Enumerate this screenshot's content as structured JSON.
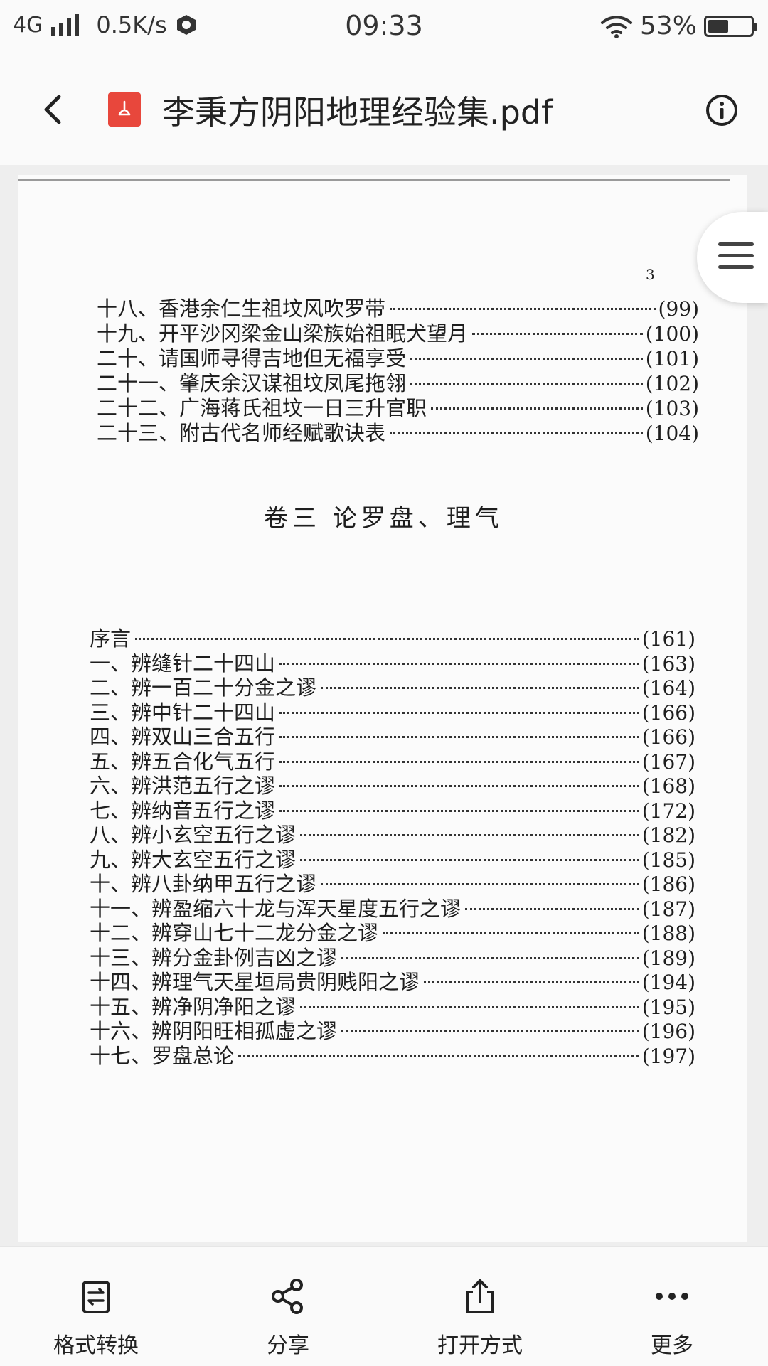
{
  "status_bar": {
    "network": "4G",
    "speed": "0.5K/s",
    "time": "09:33",
    "battery": "53%",
    "battery_level": 0.53
  },
  "header": {
    "title": "李秉方阴阳地理经验集.pdf",
    "file_icon": "pdf-icon"
  },
  "document": {
    "page_number": "3",
    "toc_part1": [
      {
        "title": "十八、香港余仁生祖坟风吹罗带",
        "page": "(99)"
      },
      {
        "title": "十九、开平沙冈梁金山梁族始祖眠犬望月",
        "page": "(100)"
      },
      {
        "title": "二十、请国师寻得吉地但无福享受",
        "page": "(101)"
      },
      {
        "title": "二十一、肇庆余汉谋祖坟凤尾拖翎",
        "page": "(102)"
      },
      {
        "title": "二十二、广海蒋氏祖坟一日三升官职",
        "page": "(103)"
      },
      {
        "title": "二十三、附古代名师经赋歌诀表",
        "page": "(104)"
      }
    ],
    "section_heading": "卷三 论罗盘、理气",
    "toc_part2": [
      {
        "title": "序言",
        "page": "(161)"
      },
      {
        "title": "一、辨缝针二十四山",
        "page": "(163)"
      },
      {
        "title": "二、辨一百二十分金之谬",
        "page": "(164)"
      },
      {
        "title": "三、辨中针二十四山",
        "page": "(166)"
      },
      {
        "title": "四、辨双山三合五行",
        "page": "(166)"
      },
      {
        "title": "五、辨五合化气五行",
        "page": "(167)"
      },
      {
        "title": "六、辨洪范五行之谬",
        "page": "(168)"
      },
      {
        "title": "七、辨纳音五行之谬",
        "page": "(172)"
      },
      {
        "title": "八、辨小玄空五行之谬",
        "page": "(182)"
      },
      {
        "title": "九、辨大玄空五行之谬",
        "page": "(185)"
      },
      {
        "title": "十、辨八卦纳甲五行之谬",
        "page": "(186)"
      },
      {
        "title": "十一、辨盈缩六十龙与浑天星度五行之谬",
        "page": "(187)"
      },
      {
        "title": "十二、辨穿山七十二龙分金之谬",
        "page": "(188)"
      },
      {
        "title": "十三、辨分金卦例吉凶之谬",
        "page": "(189)"
      },
      {
        "title": "十四、辨理气天星垣局贵阴贱阳之谬",
        "page": "(194)"
      },
      {
        "title": "十五、辨净阴净阳之谬",
        "page": "(195)"
      },
      {
        "title": "十六、辨阴阳旺相孤虚之谬",
        "page": "(196)"
      },
      {
        "title": "十七、罗盘总论",
        "page": "(197)"
      }
    ]
  },
  "bottom_bar": {
    "items": [
      {
        "label": "格式转换",
        "icon": "convert-icon"
      },
      {
        "label": "分享",
        "icon": "share-icon"
      },
      {
        "label": "打开方式",
        "icon": "open-with-icon"
      },
      {
        "label": "更多",
        "icon": "more-icon"
      }
    ]
  }
}
